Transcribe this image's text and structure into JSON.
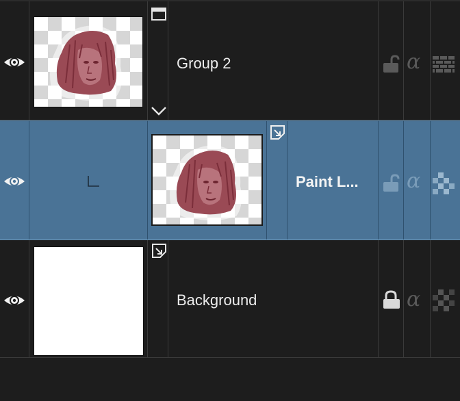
{
  "layers_panel": {
    "layers": [
      {
        "id": "group-2",
        "name": "Group 2",
        "type": "group",
        "visible": true,
        "locked": false,
        "selected": false,
        "expanded": true
      },
      {
        "id": "paint-layer",
        "name": "Paint L...",
        "type": "paint",
        "visible": true,
        "locked": false,
        "selected": true,
        "clipped_to_group": true
      },
      {
        "id": "background",
        "name": "Background",
        "type": "paint",
        "visible": true,
        "locked": true,
        "selected": false
      }
    ],
    "icons": {
      "visibility": "eye-icon",
      "group": "folder-icon",
      "expand": "chevron-down-icon",
      "layer_type": "paint-layer-icon",
      "lock_open": "unlocked-icon",
      "lock_closed": "locked-icon",
      "alpha": "alpha-lock-icon",
      "inherit_alpha": "inherit-alpha-icon"
    },
    "colors": {
      "panel_bg": "#1d1d1d",
      "selected_row": "#4a7396",
      "portrait": "#9a4a55"
    }
  }
}
